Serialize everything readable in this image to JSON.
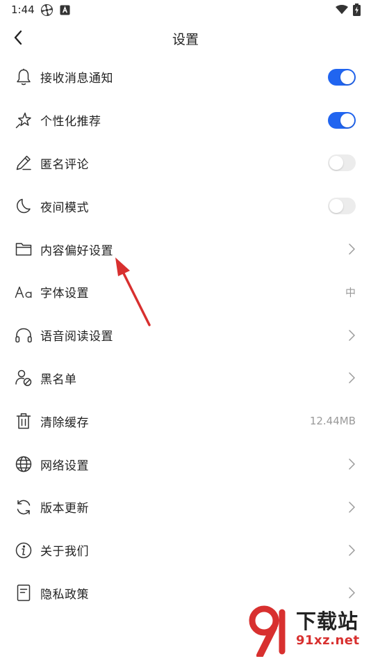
{
  "status_bar": {
    "time": "1:44",
    "icons": [
      "pinwheel-icon",
      "a-box-icon",
      "wifi-icon",
      "battery-icon"
    ]
  },
  "header": {
    "title": "设置"
  },
  "settings": [
    {
      "label": "接收消息通知",
      "icon": "bell-icon",
      "type": "toggle",
      "enabled": true
    },
    {
      "label": "个性化推荐",
      "icon": "star-icon",
      "type": "toggle",
      "enabled": true
    },
    {
      "label": "匿名评论",
      "icon": "pen-icon",
      "type": "toggle",
      "enabled": false
    },
    {
      "label": "夜间模式",
      "icon": "moon-icon",
      "type": "toggle",
      "enabled": false
    },
    {
      "label": "内容偏好设置",
      "icon": "folder-icon",
      "type": "chevron"
    },
    {
      "label": "字体设置",
      "icon": "font-icon",
      "type": "value",
      "value": "中"
    },
    {
      "label": "语音阅读设置",
      "icon": "headphones-icon",
      "type": "chevron"
    },
    {
      "label": "黑名单",
      "icon": "blocked-user-icon",
      "type": "chevron"
    },
    {
      "label": "清除缓存",
      "icon": "trash-icon",
      "type": "value",
      "value": "12.44MB"
    },
    {
      "label": "网络设置",
      "icon": "globe-icon",
      "type": "chevron"
    },
    {
      "label": "版本更新",
      "icon": "refresh-icon",
      "type": "chevron"
    },
    {
      "label": "关于我们",
      "icon": "info-icon",
      "type": "chevron"
    },
    {
      "label": "隐私政策",
      "icon": "document-icon",
      "type": "chevron"
    }
  ],
  "watermark": {
    "name": "下载站",
    "url": "91xz.net"
  },
  "colors": {
    "accent": "#2165f0",
    "toggle_off": "#ececec",
    "arrow": "#d8302f"
  }
}
